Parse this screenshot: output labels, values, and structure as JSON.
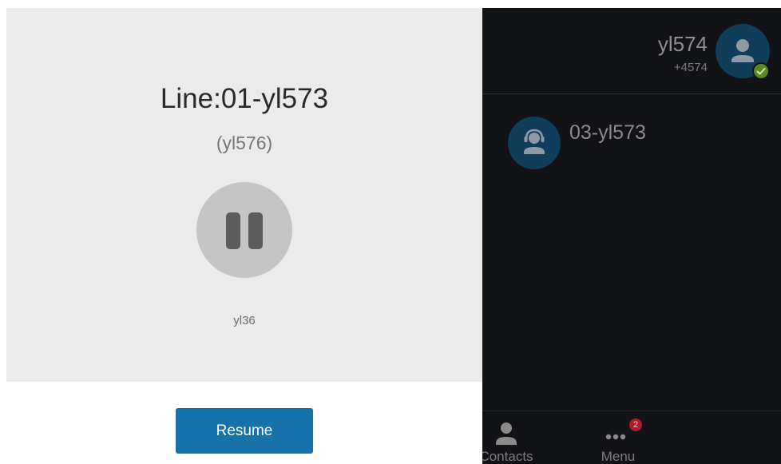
{
  "call": {
    "line_title": "Line:01-yl573",
    "remote_party": "(yl576)",
    "account": "yl36",
    "resume_label": "Resume",
    "status_icon": "pause-icon"
  },
  "user": {
    "name": "yl574",
    "extension": "+4574",
    "presence": "online",
    "avatar_icon": "user-avatar-icon"
  },
  "lines": [
    {
      "label": "03-yl573",
      "icon": "headset-avatar-icon"
    }
  ],
  "nav": {
    "contacts_label": "Contacts",
    "menu_label": "Menu",
    "menu_badge": "2"
  },
  "colors": {
    "accent_button": "#1673aa",
    "dark_panel": "#111316",
    "avatar_bg": "#0f3d5a",
    "badge": "#b3182d",
    "presence": "#5a8a1c"
  }
}
